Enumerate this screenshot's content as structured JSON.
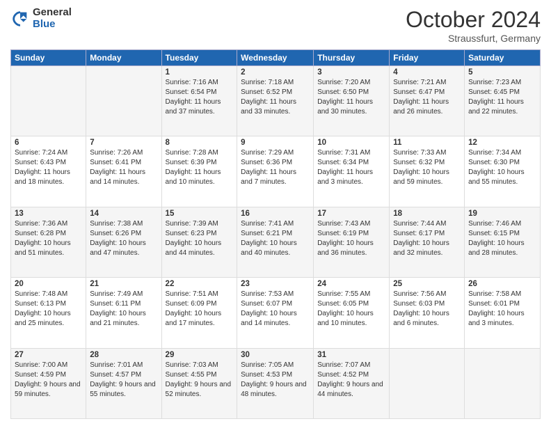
{
  "header": {
    "logo_general": "General",
    "logo_blue": "Blue",
    "month_title": "October 2024",
    "location": "Straussfurt, Germany"
  },
  "weekdays": [
    "Sunday",
    "Monday",
    "Tuesday",
    "Wednesday",
    "Thursday",
    "Friday",
    "Saturday"
  ],
  "weeks": [
    [
      {
        "day": "",
        "sunrise": "",
        "sunset": "",
        "daylight": ""
      },
      {
        "day": "",
        "sunrise": "",
        "sunset": "",
        "daylight": ""
      },
      {
        "day": "1",
        "sunrise": "Sunrise: 7:16 AM",
        "sunset": "Sunset: 6:54 PM",
        "daylight": "Daylight: 11 hours and 37 minutes."
      },
      {
        "day": "2",
        "sunrise": "Sunrise: 7:18 AM",
        "sunset": "Sunset: 6:52 PM",
        "daylight": "Daylight: 11 hours and 33 minutes."
      },
      {
        "day": "3",
        "sunrise": "Sunrise: 7:20 AM",
        "sunset": "Sunset: 6:50 PM",
        "daylight": "Daylight: 11 hours and 30 minutes."
      },
      {
        "day": "4",
        "sunrise": "Sunrise: 7:21 AM",
        "sunset": "Sunset: 6:47 PM",
        "daylight": "Daylight: 11 hours and 26 minutes."
      },
      {
        "day": "5",
        "sunrise": "Sunrise: 7:23 AM",
        "sunset": "Sunset: 6:45 PM",
        "daylight": "Daylight: 11 hours and 22 minutes."
      }
    ],
    [
      {
        "day": "6",
        "sunrise": "Sunrise: 7:24 AM",
        "sunset": "Sunset: 6:43 PM",
        "daylight": "Daylight: 11 hours and 18 minutes."
      },
      {
        "day": "7",
        "sunrise": "Sunrise: 7:26 AM",
        "sunset": "Sunset: 6:41 PM",
        "daylight": "Daylight: 11 hours and 14 minutes."
      },
      {
        "day": "8",
        "sunrise": "Sunrise: 7:28 AM",
        "sunset": "Sunset: 6:39 PM",
        "daylight": "Daylight: 11 hours and 10 minutes."
      },
      {
        "day": "9",
        "sunrise": "Sunrise: 7:29 AM",
        "sunset": "Sunset: 6:36 PM",
        "daylight": "Daylight: 11 hours and 7 minutes."
      },
      {
        "day": "10",
        "sunrise": "Sunrise: 7:31 AM",
        "sunset": "Sunset: 6:34 PM",
        "daylight": "Daylight: 11 hours and 3 minutes."
      },
      {
        "day": "11",
        "sunrise": "Sunrise: 7:33 AM",
        "sunset": "Sunset: 6:32 PM",
        "daylight": "Daylight: 10 hours and 59 minutes."
      },
      {
        "day": "12",
        "sunrise": "Sunrise: 7:34 AM",
        "sunset": "Sunset: 6:30 PM",
        "daylight": "Daylight: 10 hours and 55 minutes."
      }
    ],
    [
      {
        "day": "13",
        "sunrise": "Sunrise: 7:36 AM",
        "sunset": "Sunset: 6:28 PM",
        "daylight": "Daylight: 10 hours and 51 minutes."
      },
      {
        "day": "14",
        "sunrise": "Sunrise: 7:38 AM",
        "sunset": "Sunset: 6:26 PM",
        "daylight": "Daylight: 10 hours and 47 minutes."
      },
      {
        "day": "15",
        "sunrise": "Sunrise: 7:39 AM",
        "sunset": "Sunset: 6:23 PM",
        "daylight": "Daylight: 10 hours and 44 minutes."
      },
      {
        "day": "16",
        "sunrise": "Sunrise: 7:41 AM",
        "sunset": "Sunset: 6:21 PM",
        "daylight": "Daylight: 10 hours and 40 minutes."
      },
      {
        "day": "17",
        "sunrise": "Sunrise: 7:43 AM",
        "sunset": "Sunset: 6:19 PM",
        "daylight": "Daylight: 10 hours and 36 minutes."
      },
      {
        "day": "18",
        "sunrise": "Sunrise: 7:44 AM",
        "sunset": "Sunset: 6:17 PM",
        "daylight": "Daylight: 10 hours and 32 minutes."
      },
      {
        "day": "19",
        "sunrise": "Sunrise: 7:46 AM",
        "sunset": "Sunset: 6:15 PM",
        "daylight": "Daylight: 10 hours and 28 minutes."
      }
    ],
    [
      {
        "day": "20",
        "sunrise": "Sunrise: 7:48 AM",
        "sunset": "Sunset: 6:13 PM",
        "daylight": "Daylight: 10 hours and 25 minutes."
      },
      {
        "day": "21",
        "sunrise": "Sunrise: 7:49 AM",
        "sunset": "Sunset: 6:11 PM",
        "daylight": "Daylight: 10 hours and 21 minutes."
      },
      {
        "day": "22",
        "sunrise": "Sunrise: 7:51 AM",
        "sunset": "Sunset: 6:09 PM",
        "daylight": "Daylight: 10 hours and 17 minutes."
      },
      {
        "day": "23",
        "sunrise": "Sunrise: 7:53 AM",
        "sunset": "Sunset: 6:07 PM",
        "daylight": "Daylight: 10 hours and 14 minutes."
      },
      {
        "day": "24",
        "sunrise": "Sunrise: 7:55 AM",
        "sunset": "Sunset: 6:05 PM",
        "daylight": "Daylight: 10 hours and 10 minutes."
      },
      {
        "day": "25",
        "sunrise": "Sunrise: 7:56 AM",
        "sunset": "Sunset: 6:03 PM",
        "daylight": "Daylight: 10 hours and 6 minutes."
      },
      {
        "day": "26",
        "sunrise": "Sunrise: 7:58 AM",
        "sunset": "Sunset: 6:01 PM",
        "daylight": "Daylight: 10 hours and 3 minutes."
      }
    ],
    [
      {
        "day": "27",
        "sunrise": "Sunrise: 7:00 AM",
        "sunset": "Sunset: 4:59 PM",
        "daylight": "Daylight: 9 hours and 59 minutes."
      },
      {
        "day": "28",
        "sunrise": "Sunrise: 7:01 AM",
        "sunset": "Sunset: 4:57 PM",
        "daylight": "Daylight: 9 hours and 55 minutes."
      },
      {
        "day": "29",
        "sunrise": "Sunrise: 7:03 AM",
        "sunset": "Sunset: 4:55 PM",
        "daylight": "Daylight: 9 hours and 52 minutes."
      },
      {
        "day": "30",
        "sunrise": "Sunrise: 7:05 AM",
        "sunset": "Sunset: 4:53 PM",
        "daylight": "Daylight: 9 hours and 48 minutes."
      },
      {
        "day": "31",
        "sunrise": "Sunrise: 7:07 AM",
        "sunset": "Sunset: 4:52 PM",
        "daylight": "Daylight: 9 hours and 44 minutes."
      },
      {
        "day": "",
        "sunrise": "",
        "sunset": "",
        "daylight": ""
      },
      {
        "day": "",
        "sunrise": "",
        "sunset": "",
        "daylight": ""
      }
    ]
  ]
}
